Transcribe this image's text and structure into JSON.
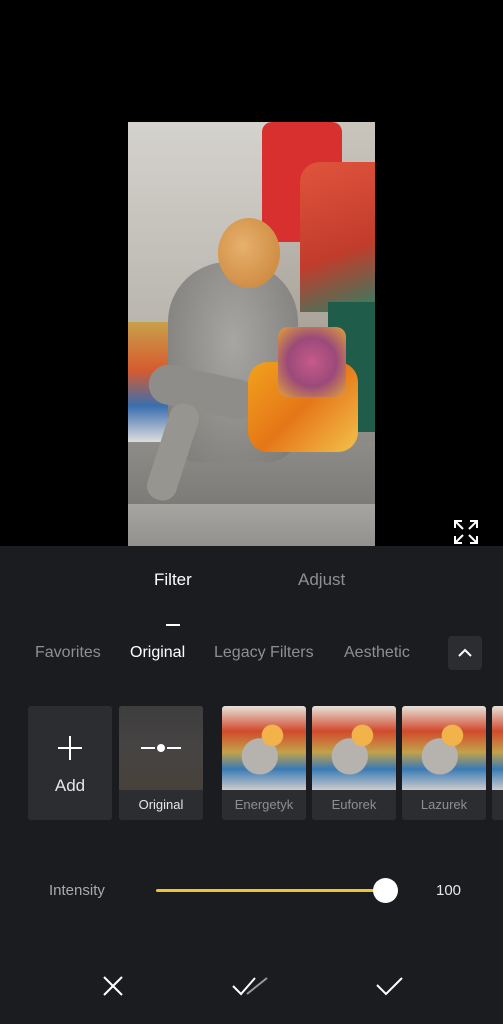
{
  "mode_tabs": [
    {
      "label": "Filter",
      "active": true
    },
    {
      "label": "Adjust",
      "active": false
    }
  ],
  "categories": [
    {
      "label": "Favorites",
      "active": false
    },
    {
      "label": "Original",
      "active": true
    },
    {
      "label": "Legacy Filters",
      "active": false
    },
    {
      "label": "Aesthetic",
      "active": false
    }
  ],
  "collapse_icon": "chevron-up-icon",
  "add_tile": {
    "label": "Add",
    "icon": "plus-icon"
  },
  "filters": [
    {
      "name": "Original",
      "selected": true
    },
    {
      "name": "Energetyk",
      "selected": false
    },
    {
      "name": "Euforek",
      "selected": false
    },
    {
      "name": "Lazurek",
      "selected": false
    }
  ],
  "intensity": {
    "label": "Intensity",
    "value": "100",
    "fraction": 1.0
  },
  "actions": {
    "cancel_icon": "close-icon",
    "apply_all_icon": "double-check-icon",
    "confirm_icon": "check-icon"
  },
  "colors": {
    "accent": "#f0c330",
    "panel": "#1b1c1f",
    "tile": "#2c2d31"
  }
}
